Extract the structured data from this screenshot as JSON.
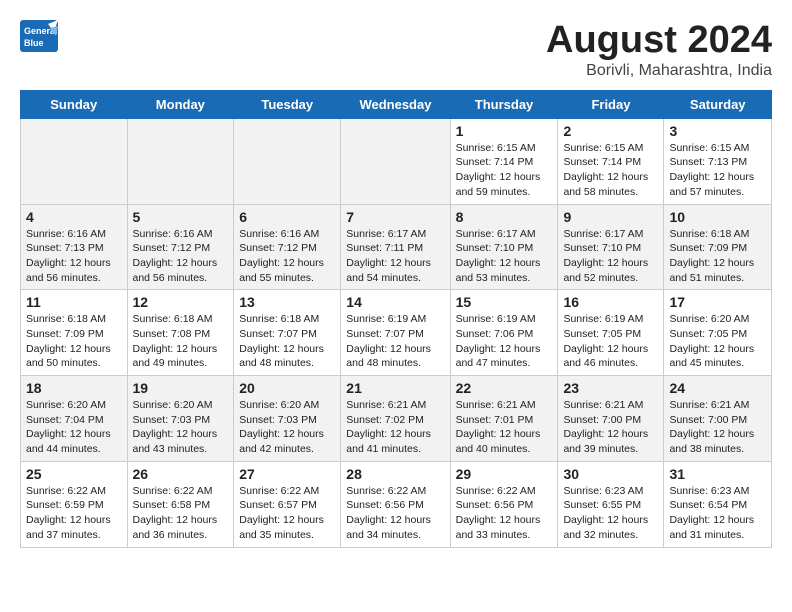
{
  "header": {
    "logo_line1": "General",
    "logo_line2": "Blue",
    "month": "August 2024",
    "location": "Borivli, Maharashtra, India"
  },
  "weekdays": [
    "Sunday",
    "Monday",
    "Tuesday",
    "Wednesday",
    "Thursday",
    "Friday",
    "Saturday"
  ],
  "weeks": [
    [
      {
        "day": "",
        "info": ""
      },
      {
        "day": "",
        "info": ""
      },
      {
        "day": "",
        "info": ""
      },
      {
        "day": "",
        "info": ""
      },
      {
        "day": "1",
        "info": "Sunrise: 6:15 AM\nSunset: 7:14 PM\nDaylight: 12 hours\nand 59 minutes."
      },
      {
        "day": "2",
        "info": "Sunrise: 6:15 AM\nSunset: 7:14 PM\nDaylight: 12 hours\nand 58 minutes."
      },
      {
        "day": "3",
        "info": "Sunrise: 6:15 AM\nSunset: 7:13 PM\nDaylight: 12 hours\nand 57 minutes."
      }
    ],
    [
      {
        "day": "4",
        "info": "Sunrise: 6:16 AM\nSunset: 7:13 PM\nDaylight: 12 hours\nand 56 minutes."
      },
      {
        "day": "5",
        "info": "Sunrise: 6:16 AM\nSunset: 7:12 PM\nDaylight: 12 hours\nand 56 minutes."
      },
      {
        "day": "6",
        "info": "Sunrise: 6:16 AM\nSunset: 7:12 PM\nDaylight: 12 hours\nand 55 minutes."
      },
      {
        "day": "7",
        "info": "Sunrise: 6:17 AM\nSunset: 7:11 PM\nDaylight: 12 hours\nand 54 minutes."
      },
      {
        "day": "8",
        "info": "Sunrise: 6:17 AM\nSunset: 7:10 PM\nDaylight: 12 hours\nand 53 minutes."
      },
      {
        "day": "9",
        "info": "Sunrise: 6:17 AM\nSunset: 7:10 PM\nDaylight: 12 hours\nand 52 minutes."
      },
      {
        "day": "10",
        "info": "Sunrise: 6:18 AM\nSunset: 7:09 PM\nDaylight: 12 hours\nand 51 minutes."
      }
    ],
    [
      {
        "day": "11",
        "info": "Sunrise: 6:18 AM\nSunset: 7:09 PM\nDaylight: 12 hours\nand 50 minutes."
      },
      {
        "day": "12",
        "info": "Sunrise: 6:18 AM\nSunset: 7:08 PM\nDaylight: 12 hours\nand 49 minutes."
      },
      {
        "day": "13",
        "info": "Sunrise: 6:18 AM\nSunset: 7:07 PM\nDaylight: 12 hours\nand 48 minutes."
      },
      {
        "day": "14",
        "info": "Sunrise: 6:19 AM\nSunset: 7:07 PM\nDaylight: 12 hours\nand 48 minutes."
      },
      {
        "day": "15",
        "info": "Sunrise: 6:19 AM\nSunset: 7:06 PM\nDaylight: 12 hours\nand 47 minutes."
      },
      {
        "day": "16",
        "info": "Sunrise: 6:19 AM\nSunset: 7:05 PM\nDaylight: 12 hours\nand 46 minutes."
      },
      {
        "day": "17",
        "info": "Sunrise: 6:20 AM\nSunset: 7:05 PM\nDaylight: 12 hours\nand 45 minutes."
      }
    ],
    [
      {
        "day": "18",
        "info": "Sunrise: 6:20 AM\nSunset: 7:04 PM\nDaylight: 12 hours\nand 44 minutes."
      },
      {
        "day": "19",
        "info": "Sunrise: 6:20 AM\nSunset: 7:03 PM\nDaylight: 12 hours\nand 43 minutes."
      },
      {
        "day": "20",
        "info": "Sunrise: 6:20 AM\nSunset: 7:03 PM\nDaylight: 12 hours\nand 42 minutes."
      },
      {
        "day": "21",
        "info": "Sunrise: 6:21 AM\nSunset: 7:02 PM\nDaylight: 12 hours\nand 41 minutes."
      },
      {
        "day": "22",
        "info": "Sunrise: 6:21 AM\nSunset: 7:01 PM\nDaylight: 12 hours\nand 40 minutes."
      },
      {
        "day": "23",
        "info": "Sunrise: 6:21 AM\nSunset: 7:00 PM\nDaylight: 12 hours\nand 39 minutes."
      },
      {
        "day": "24",
        "info": "Sunrise: 6:21 AM\nSunset: 7:00 PM\nDaylight: 12 hours\nand 38 minutes."
      }
    ],
    [
      {
        "day": "25",
        "info": "Sunrise: 6:22 AM\nSunset: 6:59 PM\nDaylight: 12 hours\nand 37 minutes."
      },
      {
        "day": "26",
        "info": "Sunrise: 6:22 AM\nSunset: 6:58 PM\nDaylight: 12 hours\nand 36 minutes."
      },
      {
        "day": "27",
        "info": "Sunrise: 6:22 AM\nSunset: 6:57 PM\nDaylight: 12 hours\nand 35 minutes."
      },
      {
        "day": "28",
        "info": "Sunrise: 6:22 AM\nSunset: 6:56 PM\nDaylight: 12 hours\nand 34 minutes."
      },
      {
        "day": "29",
        "info": "Sunrise: 6:22 AM\nSunset: 6:56 PM\nDaylight: 12 hours\nand 33 minutes."
      },
      {
        "day": "30",
        "info": "Sunrise: 6:23 AM\nSunset: 6:55 PM\nDaylight: 12 hours\nand 32 minutes."
      },
      {
        "day": "31",
        "info": "Sunrise: 6:23 AM\nSunset: 6:54 PM\nDaylight: 12 hours\nand 31 minutes."
      }
    ]
  ]
}
